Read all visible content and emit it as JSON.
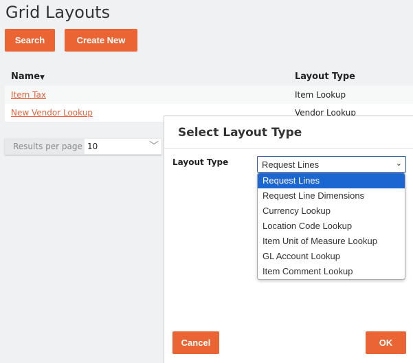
{
  "page": {
    "title": "Grid Layouts"
  },
  "toolbar": {
    "search": "Search",
    "create": "Create New"
  },
  "table": {
    "headers": {
      "name": "Name",
      "type": "Layout Type"
    },
    "sort_icon": "caret-down-icon",
    "rows": [
      {
        "name": "Item Tax",
        "type": "Item Lookup"
      },
      {
        "name": "New Vendor Lookup",
        "type": "Vendor Lookup"
      }
    ]
  },
  "pager": {
    "label": "Results per page",
    "value": "10"
  },
  "modal": {
    "title": "Select Layout Type",
    "label": "Layout Type",
    "selected": "Request Lines",
    "options": [
      "Request Lines",
      "Request Line Dimensions",
      "Currency Lookup",
      "Location Code Lookup",
      "Item Unit of Measure Lookup",
      "GL Account Lookup",
      "Item Comment Lookup"
    ],
    "cancel": "Cancel",
    "ok": "OK"
  },
  "colors": {
    "accent": "#eb6534",
    "highlight": "#1c66d1"
  }
}
